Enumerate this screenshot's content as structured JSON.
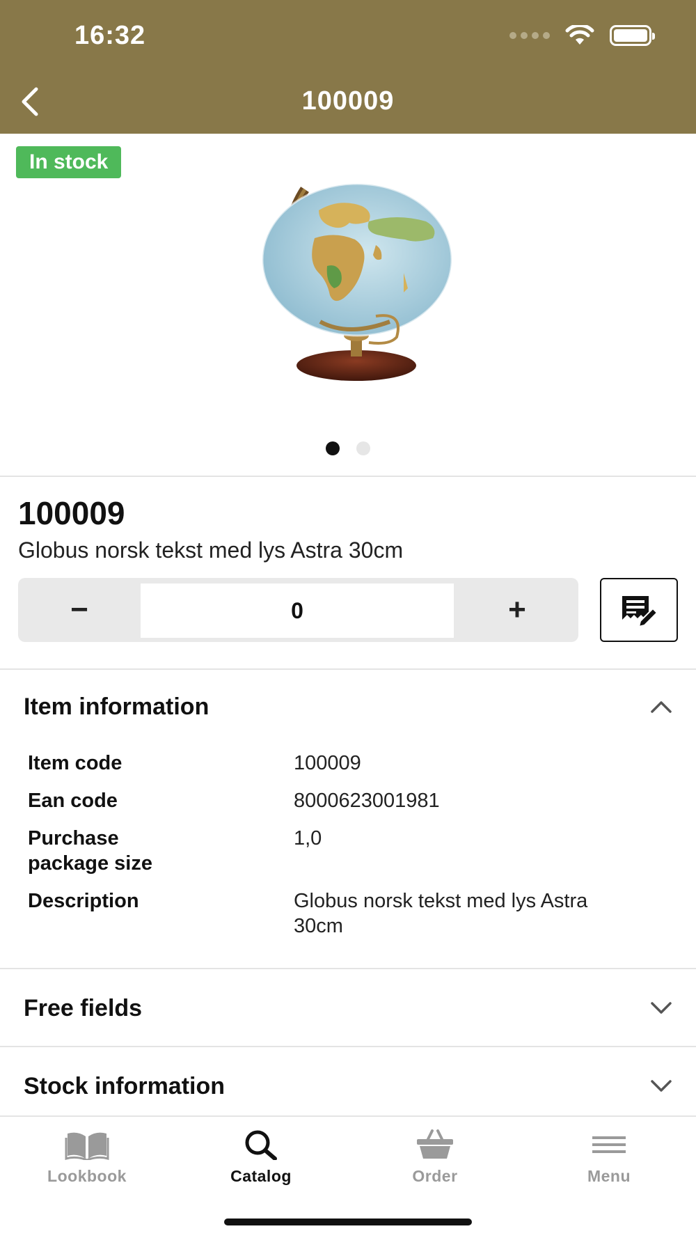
{
  "status_bar": {
    "time": "16:32"
  },
  "header": {
    "title": "100009"
  },
  "product": {
    "stock_badge": "In stock",
    "code": "100009",
    "name": "Globus norsk tekst med lys Astra 30cm",
    "image_alt": "globe-product-photo",
    "pager": {
      "count": 2,
      "active_index": 0
    }
  },
  "quantity": {
    "value": "0",
    "minus_label": "−",
    "plus_label": "+"
  },
  "sections": {
    "item_information": {
      "title": "Item information",
      "expanded": true,
      "rows": [
        {
          "label": "Item code",
          "value": "100009"
        },
        {
          "label": "Ean code",
          "value": "8000623001981"
        },
        {
          "label": "Purchase package size",
          "value": "1,0"
        },
        {
          "label": "Description",
          "value": "Globus norsk tekst med lys Astra 30cm"
        }
      ]
    },
    "free_fields": {
      "title": "Free fields",
      "expanded": false
    },
    "stock_information": {
      "title": "Stock information",
      "expanded": false
    }
  },
  "tabbar": {
    "tabs": [
      {
        "label": "Lookbook",
        "icon": "book-icon",
        "active": false
      },
      {
        "label": "Catalog",
        "icon": "search-icon",
        "active": true
      },
      {
        "label": "Order",
        "icon": "basket-icon",
        "active": false
      },
      {
        "label": "Menu",
        "icon": "menu-icon",
        "active": false
      }
    ]
  },
  "colors": {
    "header": "#887849",
    "stock_badge": "#4fb95a",
    "inactive_tab": "#9a9a9a"
  }
}
